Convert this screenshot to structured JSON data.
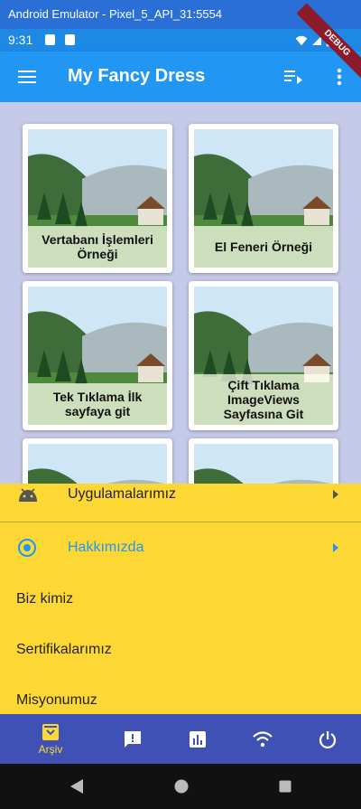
{
  "emulator": {
    "title": "Android Emulator - Pixel_5_API_31:5554"
  },
  "status_bar": {
    "time": "9:31"
  },
  "debug_banner": "DEBUG",
  "app_bar": {
    "title": "My Fancy Dress",
    "menu_icon": "menu-icon",
    "queue_icon": "playlist-play-icon",
    "more_icon": "more-vert-icon"
  },
  "grid": {
    "cards": [
      {
        "caption": "Vertabanı İşlemleri Örneği"
      },
      {
        "caption": "El Feneri Örneği"
      },
      {
        "caption": "Tek Tıklama İlk sayfaya git"
      },
      {
        "caption": "Çift Tıklama ImageViews Sayfasına Git"
      },
      {
        "caption": ""
      },
      {
        "caption": ""
      }
    ]
  },
  "panel": {
    "items": [
      {
        "label": "Uygulamalarımız",
        "icon": "android-icon"
      },
      {
        "label": "Hakkımızda",
        "icon": "radio-target-icon"
      },
      {
        "label": "Biz kimiz"
      },
      {
        "label": "Sertifikalarımız"
      },
      {
        "label": "Misyonumuz"
      }
    ],
    "active_color": "#2196f3"
  },
  "bottom_nav": {
    "items": [
      {
        "label": "Arşiv",
        "icon": "archive-icon"
      },
      {
        "label": "",
        "icon": "feedback-icon"
      },
      {
        "label": "",
        "icon": "bar-chart-icon"
      },
      {
        "label": "",
        "icon": "wifi-icon"
      },
      {
        "label": "",
        "icon": "power-icon"
      }
    ],
    "accent": "#fdd835"
  },
  "system_nav": {
    "back_icon": "back-triangle-icon",
    "home_icon": "home-circle-icon",
    "recents_icon": "recents-square-icon"
  }
}
